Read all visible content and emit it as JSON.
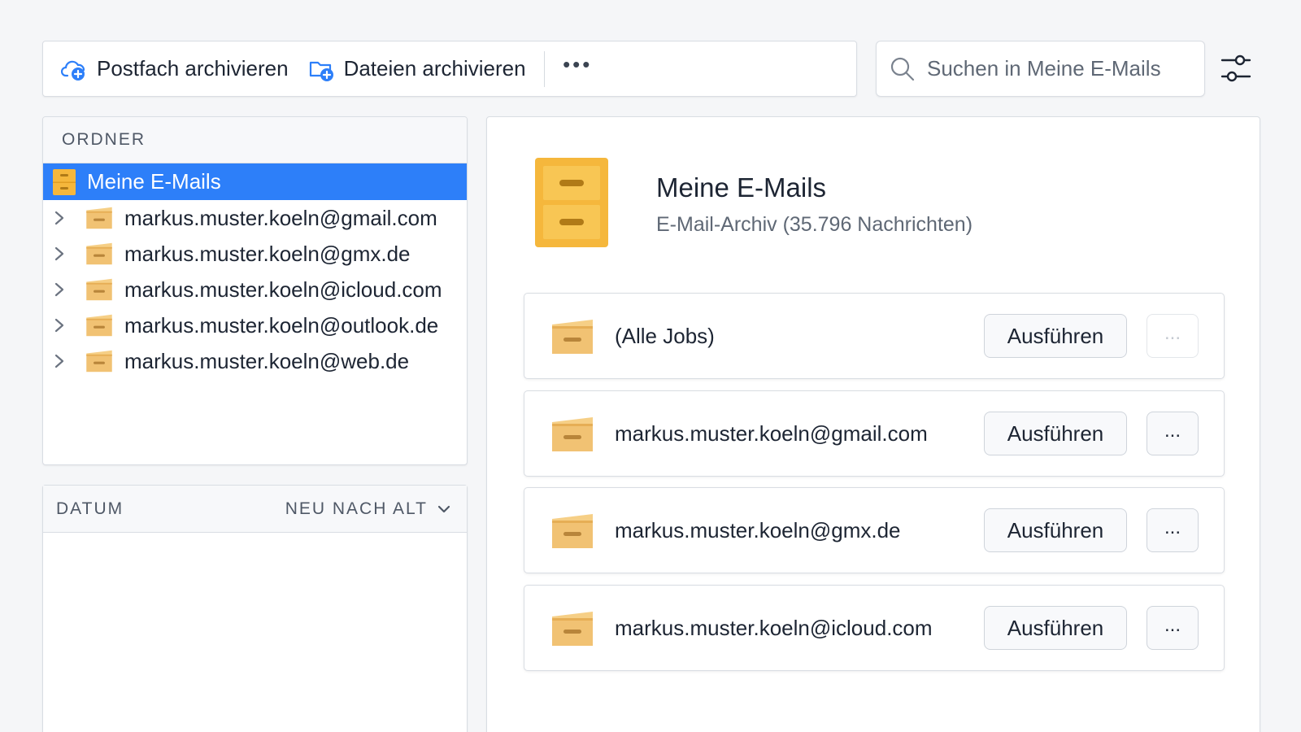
{
  "toolbar": {
    "archive_mailbox_label": "Postfach archivieren",
    "archive_files_label": "Dateien archivieren",
    "more_label": "•••"
  },
  "search": {
    "placeholder": "Suchen in Meine E-Mails"
  },
  "folders": {
    "header": "ORDNER",
    "root": "Meine E-Mails",
    "items": [
      {
        "label": "markus.muster.koeln@gmail.com"
      },
      {
        "label": "markus.muster.koeln@gmx.de"
      },
      {
        "label": "markus.muster.koeln@icloud.com"
      },
      {
        "label": "markus.muster.koeln@outlook.de"
      },
      {
        "label": "markus.muster.koeln@web.de"
      }
    ]
  },
  "date_panel": {
    "header": "DATUM",
    "sort_label": "NEU NACH ALT"
  },
  "archive": {
    "title": "Meine E-Mails",
    "subtitle": "E-Mail-Archiv (35.796 Nachrichten)"
  },
  "jobs": [
    {
      "label": "(Alle Jobs)",
      "run_label": "Ausführen",
      "more_label": "...",
      "more_enabled": false
    },
    {
      "label": "markus.muster.koeln@gmail.com",
      "run_label": "Ausführen",
      "more_label": "...",
      "more_enabled": true
    },
    {
      "label": "markus.muster.koeln@gmx.de",
      "run_label": "Ausführen",
      "more_label": "...",
      "more_enabled": true
    },
    {
      "label": "markus.muster.koeln@icloud.com",
      "run_label": "Ausführen",
      "more_label": "...",
      "more_enabled": true
    }
  ],
  "colors": {
    "accent": "#2d7ff9",
    "folder_yellow": "#f5b73c",
    "box_orange": "#f1c273"
  }
}
